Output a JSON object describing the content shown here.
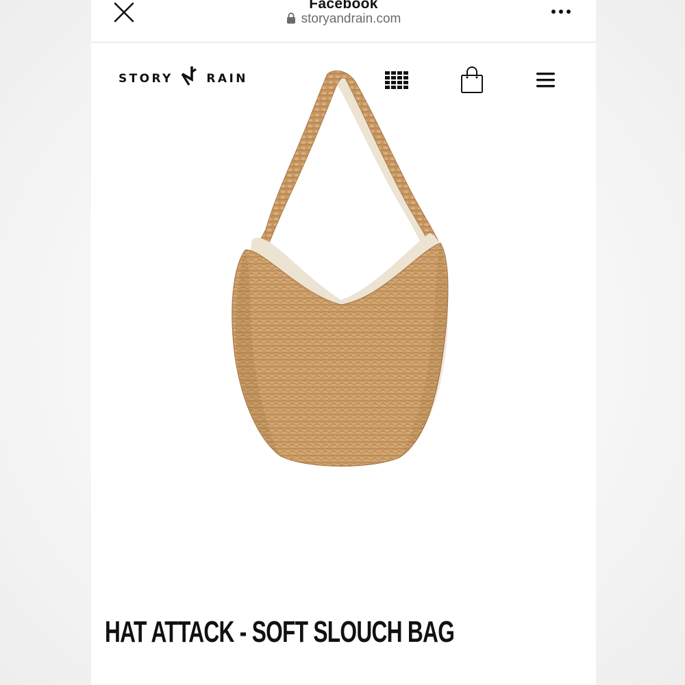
{
  "browser": {
    "title": "Facebook",
    "url": "storyandrain.com"
  },
  "site": {
    "logo_left": "STORY",
    "logo_right": "RAIN"
  },
  "product": {
    "title": "HAT ATTACK - SOFT SLOUCH BAG"
  },
  "colors": {
    "background": "#ffffff",
    "text": "#111111",
    "url_text": "#6b6b6b",
    "bag_straw": "#c99a62",
    "bag_lining": "#ece3d2"
  },
  "icons": {
    "close": "close-icon",
    "lock": "lock-icon",
    "more": "more-dots-icon",
    "logo_mark": "logo-arrow-icon",
    "grid": "grid-icon",
    "bag": "shopping-bag-icon",
    "menu": "hamburger-menu-icon"
  }
}
